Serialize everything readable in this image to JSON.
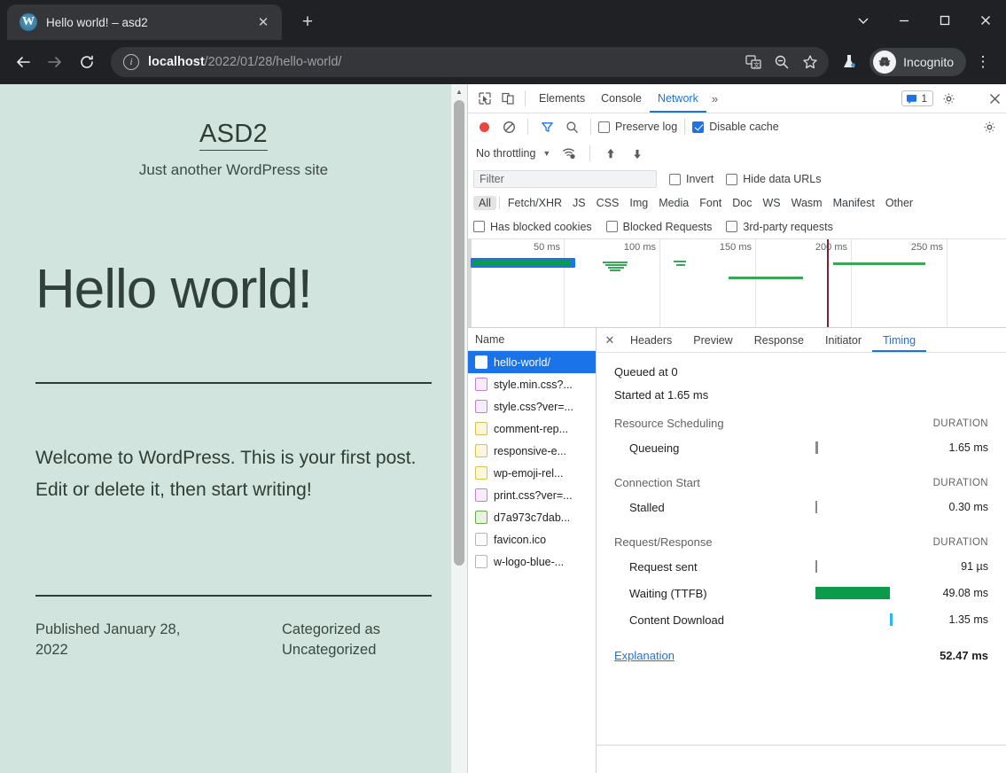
{
  "browser": {
    "tab": {
      "title": "Hello world! – asd2",
      "favicon": "wordpress-icon",
      "close": "✕"
    },
    "new_tab": "+",
    "window_controls": {
      "minimize": "minimize-icon",
      "maximize": "maximize-icon",
      "close": "close-icon",
      "chevron": "chevron-down-icon"
    },
    "nav": {
      "back": "back-arrow-icon",
      "forward": "forward-arrow-icon",
      "reload": "reload-icon"
    },
    "omnibox": {
      "info_icon": "i",
      "url_host": "localhost",
      "url_path": "/2022/01/28/hello-world/",
      "translate_icon": "translate-icon",
      "zoom_icon": "zoom-out-icon",
      "bookmark_icon": "star-icon"
    },
    "profile": {
      "lab_icon": "beaker-icon",
      "incognito_label": "Incognito",
      "avatar": "incognito-icon"
    },
    "menu": "⋮"
  },
  "page": {
    "site_title": "ASD2",
    "site_description": "Just another WordPress site",
    "post_title": "Hello world!",
    "post_body": "Welcome to WordPress. This is your first post. Edit or delete it, then start writing!",
    "published": "Published January 28, 2022",
    "published_line1": "Published January 28,",
    "published_line2": "2022",
    "categorized_line1": "Categorized as",
    "categorized_line2": "Uncategorized",
    "background_color": "#d1e4dd",
    "text_color": "#2f3e35"
  },
  "devtools": {
    "panel_tabs": [
      {
        "label": "Elements",
        "active": false
      },
      {
        "label": "Console",
        "active": false
      },
      {
        "label": "Network",
        "active": true
      }
    ],
    "more_tabs": "»",
    "message_count": "1",
    "settings_icon": "gear-icon",
    "kebab_icon": "more-vertical-icon",
    "close_icon": "close-icon",
    "inspect_icon": "inspect-element-icon",
    "device_icon": "device-toolbar-icon",
    "toolbar": {
      "record_icon": "record-icon",
      "clear_icon": "clear-icon",
      "filter_icon": "filter-icon",
      "search_icon": "search-icon",
      "preserve_log": {
        "label": "Preserve log",
        "checked": false
      },
      "disable_cache": {
        "label": "Disable cache",
        "checked": true
      },
      "network_settings_icon": "gear-icon"
    },
    "throttling": {
      "label": "No throttling",
      "caret": "▼",
      "wifi_icon": "wifi-settings-icon",
      "upload_icon": "upload-icon",
      "download_icon": "download-icon"
    },
    "filter": {
      "placeholder": "Filter",
      "invert": {
        "label": "Invert",
        "checked": false
      },
      "hide_data_urls": {
        "label": "Hide data URLs",
        "checked": false
      }
    },
    "types": [
      "All",
      "Fetch/XHR",
      "JS",
      "CSS",
      "Img",
      "Media",
      "Font",
      "Doc",
      "WS",
      "Wasm",
      "Manifest",
      "Other"
    ],
    "types_selected": "All",
    "flags": [
      {
        "label": "Has blocked cookies",
        "checked": false
      },
      {
        "label": "Blocked Requests",
        "checked": false
      },
      {
        "label": "3rd-party requests",
        "checked": false
      }
    ],
    "overview": {
      "tick_labels": [
        "50 ms",
        "100 ms",
        "150 ms",
        "200 ms",
        "250 ms"
      ],
      "red_marker_ms": 200
    },
    "requests": {
      "column_header": "Name",
      "rows": [
        {
          "name": "hello-world/",
          "type": "doc",
          "selected": true
        },
        {
          "name": "style.min.css?...",
          "type": "css",
          "selected": false
        },
        {
          "name": "style.css?ver=...",
          "type": "css",
          "selected": false
        },
        {
          "name": "comment-rep...",
          "type": "js",
          "selected": false
        },
        {
          "name": "responsive-e...",
          "type": "js",
          "selected": false
        },
        {
          "name": "wp-emoji-rel...",
          "type": "js",
          "selected": false
        },
        {
          "name": "print.css?ver=...",
          "type": "css",
          "selected": false
        },
        {
          "name": "d7a973c7dab...",
          "type": "img",
          "selected": false
        },
        {
          "name": "favicon.ico",
          "type": "other",
          "selected": false
        },
        {
          "name": "w-logo-blue-...",
          "type": "other",
          "selected": false
        }
      ]
    },
    "detail": {
      "close": "✕",
      "tabs": [
        {
          "label": "Headers",
          "active": false
        },
        {
          "label": "Preview",
          "active": false
        },
        {
          "label": "Response",
          "active": false
        },
        {
          "label": "Initiator",
          "active": false
        },
        {
          "label": "Timing",
          "active": true
        }
      ],
      "timing": {
        "queued_at": "Queued at 0",
        "started_at": "Started at 1.65 ms",
        "duration_header": "DURATION",
        "sections": [
          {
            "name": "Resource Scheduling",
            "items": [
              {
                "name": "Queueing",
                "value": "1.65 ms",
                "bar": "thin",
                "offset_pct": 27,
                "width_pct": 1
              }
            ]
          },
          {
            "name": "Connection Start",
            "items": [
              {
                "name": "Stalled",
                "value": "0.30 ms",
                "bar": "thin",
                "offset_pct": 27,
                "width_pct": 1
              }
            ]
          },
          {
            "name": "Request/Response",
            "items": [
              {
                "name": "Request sent",
                "value": "91 µs",
                "bar": "thin",
                "offset_pct": 27,
                "width_pct": 1
              },
              {
                "name": "Waiting (TTFB)",
                "value": "49.08 ms",
                "bar": "green",
                "offset_pct": 27,
                "width_pct": 53
              },
              {
                "name": "Content Download",
                "value": "1.35 ms",
                "bar": "blue",
                "offset_pct": 80,
                "width_pct": 1
              }
            ]
          }
        ],
        "explanation_link": "Explanation",
        "total": "52.47 ms"
      }
    }
  }
}
